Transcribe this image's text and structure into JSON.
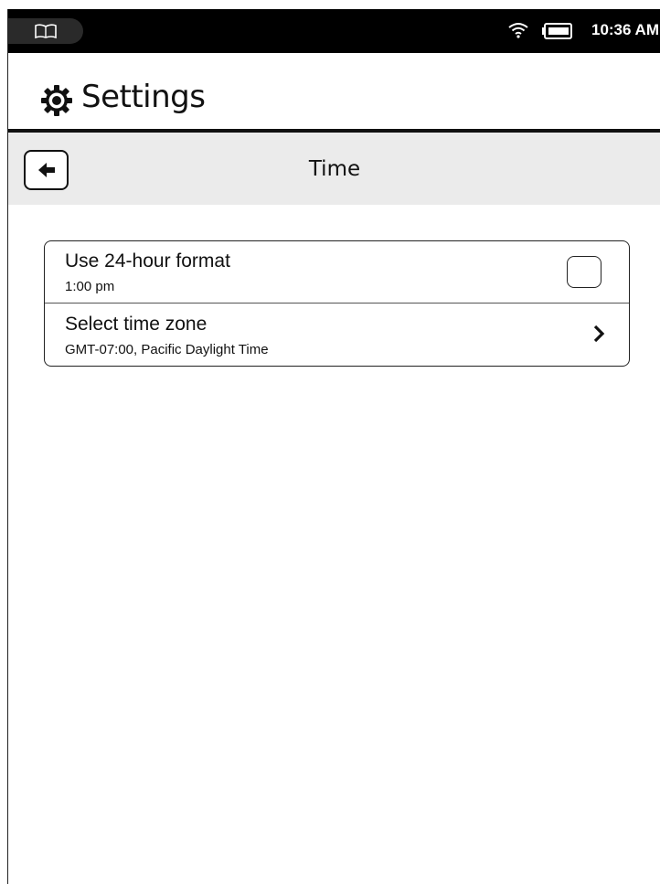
{
  "status_bar": {
    "time": "10:36 AM",
    "icons": [
      "book-icon",
      "wifi-icon",
      "battery-icon"
    ]
  },
  "header": {
    "title": "Settings",
    "icon": "gear-icon"
  },
  "subheader": {
    "title": "Time",
    "back_icon": "back-arrow-icon"
  },
  "settings": {
    "items": [
      {
        "title": "Use 24-hour format",
        "subtitle": "1:00 pm",
        "control": "checkbox",
        "checked": false
      },
      {
        "title": "Select time zone",
        "subtitle": "GMT-07:00, Pacific Daylight Time",
        "control": "chevron-right-icon"
      }
    ]
  },
  "colors": {
    "status_bar_bg": "#000000",
    "subheader_bg": "#ebebeb",
    "text": "#111111"
  }
}
